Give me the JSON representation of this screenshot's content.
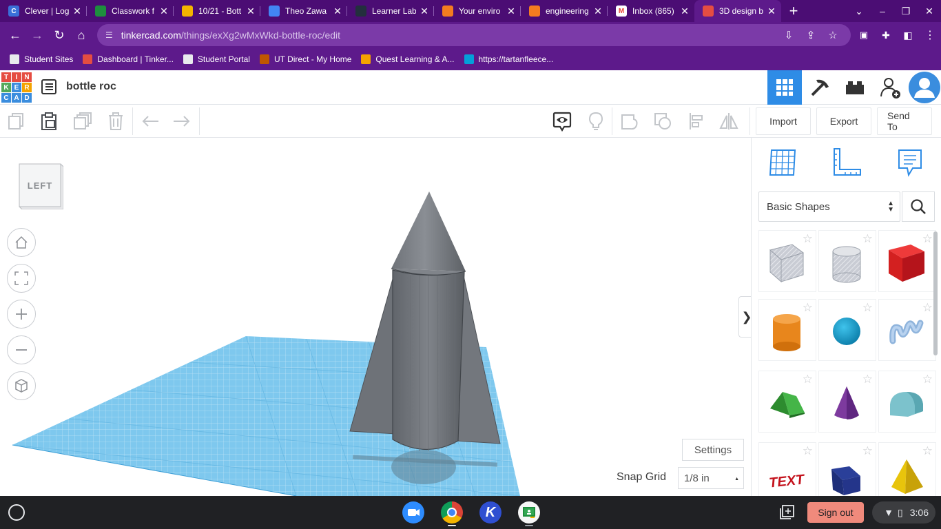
{
  "browser": {
    "tabs": [
      {
        "title": "Clever | Log",
        "fav_color": "#3a6fd8",
        "fav_glyph": "C"
      },
      {
        "title": "Classwork f",
        "fav_color": "#1e8e3e",
        "fav_glyph": ""
      },
      {
        "title": "10/21 - Bott",
        "fav_color": "#f4b400",
        "fav_glyph": ""
      },
      {
        "title": "Theo Zawa",
        "fav_color": "#4285f4",
        "fav_glyph": ""
      },
      {
        "title": "Learner Lab",
        "fav_color": "#232f3e",
        "fav_glyph": ""
      },
      {
        "title": "Your enviro",
        "fav_color": "#f47c20",
        "fav_glyph": ""
      },
      {
        "title": "engineering",
        "fav_color": "#f47c20",
        "fav_glyph": ""
      },
      {
        "title": "Inbox (865)",
        "fav_color": "#ffffff",
        "fav_glyph": "M"
      },
      {
        "title": "3D design b",
        "fav_color": "#e54d42",
        "fav_glyph": "",
        "active": true
      }
    ],
    "url_host": "tinkercad.com",
    "url_path": "/things/exXg2wMxWkd-bottle-roc/edit",
    "bookmarks": [
      {
        "label": "Student Sites",
        "color": "#e8eaed"
      },
      {
        "label": "Dashboard | Tinker...",
        "color": "#e54d42"
      },
      {
        "label": "Student Portal",
        "color": "#e8eaed"
      },
      {
        "label": "UT Direct - My Home",
        "color": "#bf5700"
      },
      {
        "label": "Quest Learning & A...",
        "color": "#f4a300"
      },
      {
        "label": "https://tartanfleece...",
        "color": "#049fd9"
      }
    ]
  },
  "tinkercad": {
    "design_name": "bottle roc",
    "toolbar": {
      "import_label": "Import",
      "export_label": "Export",
      "send_to_label": "Send To"
    },
    "viewcube_label": "LEFT",
    "settings_label": "Settings",
    "snap_grid_label": "Snap Grid",
    "snap_grid_value": "1/8 in",
    "expander_glyph": "❯",
    "panel": {
      "category": "Basic Shapes",
      "shapes": [
        {
          "name": "box-hole"
        },
        {
          "name": "cylinder-hole"
        },
        {
          "name": "box"
        },
        {
          "name": "cylinder"
        },
        {
          "name": "sphere"
        },
        {
          "name": "scribble"
        },
        {
          "name": "roof"
        },
        {
          "name": "cone"
        },
        {
          "name": "round-roof"
        },
        {
          "name": "text"
        },
        {
          "name": "wedge"
        },
        {
          "name": "pyramid"
        }
      ]
    },
    "colors": {
      "accent_blue": "#2e8ce6",
      "grid_blue": "#7ec8ee",
      "rocket_gray": "#7b7f85",
      "logo_red": "#e54d42",
      "logo_orange": "#f4a300",
      "logo_green": "#52a95a",
      "logo_blue": "#3a8dde"
    }
  },
  "shelf": {
    "sign_out_label": "Sign out",
    "time": "3:06"
  }
}
